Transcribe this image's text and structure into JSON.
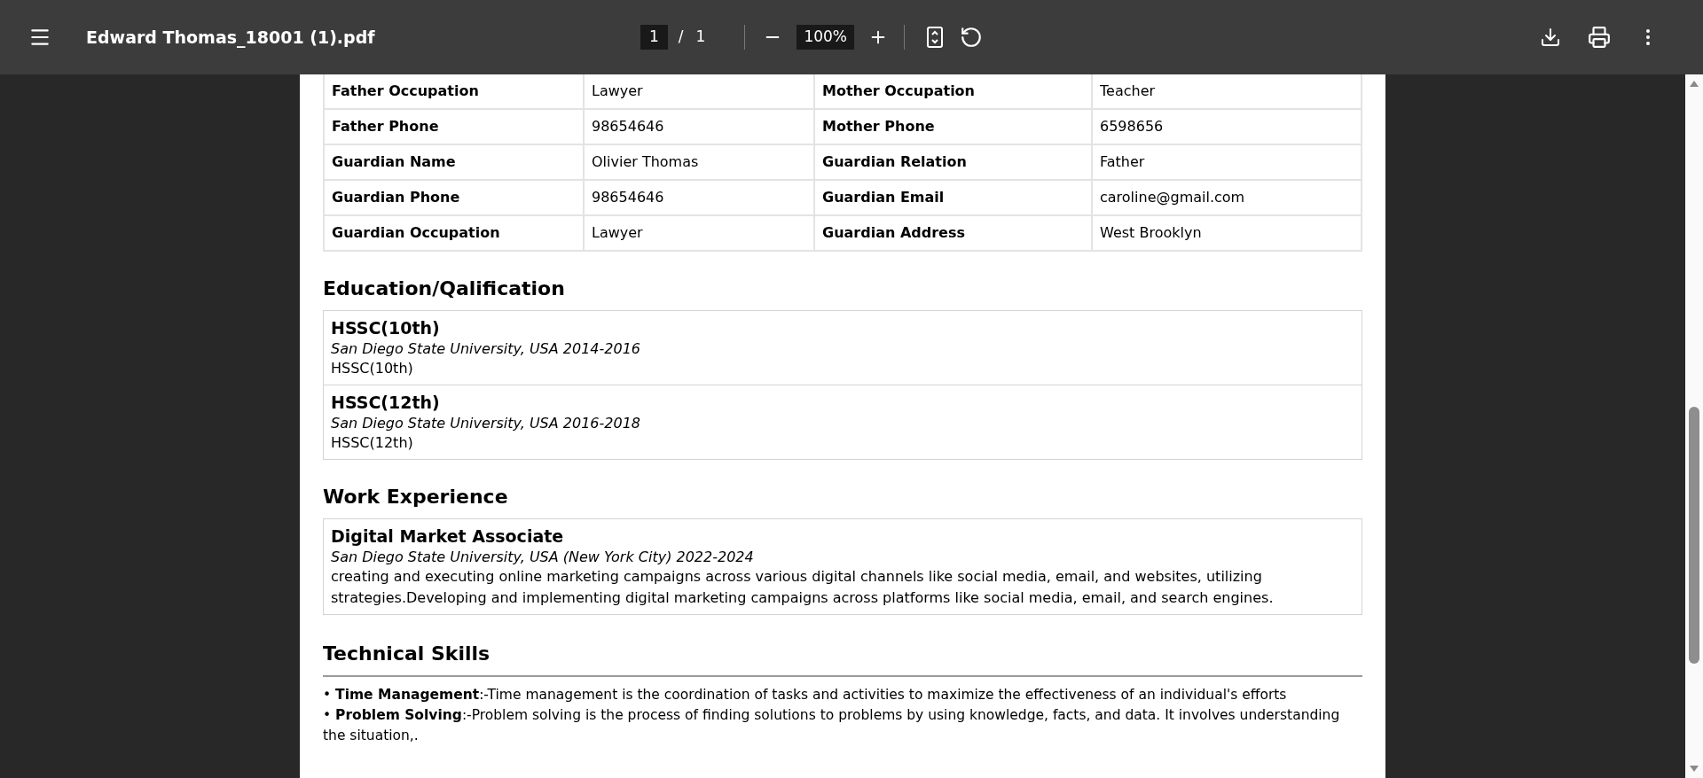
{
  "toolbar": {
    "title": "Edward Thomas_18001 (1).pdf",
    "page_current": "1",
    "page_separator": "/",
    "page_total": "1",
    "zoom": "100%"
  },
  "family_table": [
    {
      "cells": [
        {
          "label": "Father Occupation",
          "value": "Lawyer"
        },
        {
          "label": "Mother Occupation",
          "value": "Teacher"
        }
      ]
    },
    {
      "cells": [
        {
          "label": "Father Phone",
          "value": "98654646"
        },
        {
          "label": "Mother Phone",
          "value": "6598656"
        }
      ]
    },
    {
      "cells": [
        {
          "label": "Guardian Name",
          "value": "Olivier Thomas"
        },
        {
          "label": "Guardian Relation",
          "value": "Father"
        }
      ]
    },
    {
      "cells": [
        {
          "label": "Guardian Phone",
          "value": "98654646"
        },
        {
          "label": "Guardian Email",
          "value": "caroline@gmail.com"
        }
      ]
    },
    {
      "cells": [
        {
          "label": "Guardian Occupation",
          "value": "Lawyer"
        },
        {
          "label": "Guardian Address",
          "value": "West Brooklyn"
        }
      ]
    }
  ],
  "education": {
    "heading": "Education/Qalification",
    "entries": [
      {
        "title": "HSSC(10th)",
        "subtitle": "San Diego State University, USA 2014-2016",
        "description": "HSSC(10th)"
      },
      {
        "title": "HSSC(12th)",
        "subtitle": "San Diego State University, USA 2016-2018",
        "description": "HSSC(12th)"
      }
    ]
  },
  "work": {
    "heading": "Work Experience",
    "entries": [
      {
        "title": "Digital Market Associate",
        "subtitle": "San Diego State University, USA (New York City) 2022-2024",
        "description": "creating and executing online marketing campaigns across various digital channels like social media, email, and websites, utilizing strategies.Developing and implementing digital marketing campaigns across platforms like social media, email, and search engines."
      }
    ]
  },
  "skills": {
    "heading": "Technical Skills",
    "items": [
      "• **Time Management**:-Time management is the coordination of tasks and activities to maximize the effectiveness of an individual's efforts",
      "• **Problem Solving**:-Problem solving is the process of finding solutions to problems by using knowledge, facts, and data. It involves understanding the situation,."
    ]
  }
}
